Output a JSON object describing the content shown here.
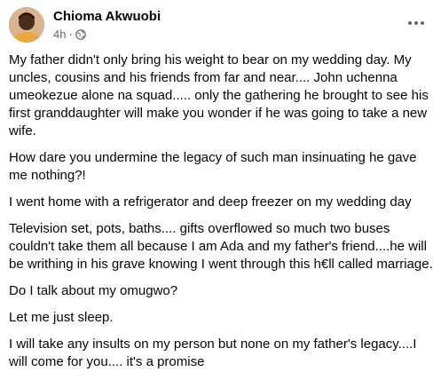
{
  "post": {
    "author": "Chioma Akwuobi",
    "time": "4h",
    "separator": "·",
    "audience_icon": "globe-icon",
    "more_icon": "more-horizontal-icon",
    "paragraphs": [
      "My father didn't only bring his weight to bear on my wedding day. My uncles, cousins and his friends from far and near.... John uchenna umeokezue alone na squad..... only the gathering he brought to see his first granddaughter will make you wonder if he was going to take a new wife.",
      "How dare you undermine the legacy of such man insinuating he gave me nothing?!",
      "I went home with a refrigerator and deep freezer on my wedding day",
      "Television set, pots, baths.... gifts overflowed so much two buses couldn't take them all because I am Ada and my father's friend....he will be writhing in his grave knowing I went through this h€ll called marriage.",
      "Do I talk about my omugwo?",
      "Let me just sleep.",
      "I will take any insults on my person but none on my father's legacy....I will come for you.... it's a promise"
    ]
  },
  "colors": {
    "text": "#050505",
    "secondary": "#65676b"
  }
}
